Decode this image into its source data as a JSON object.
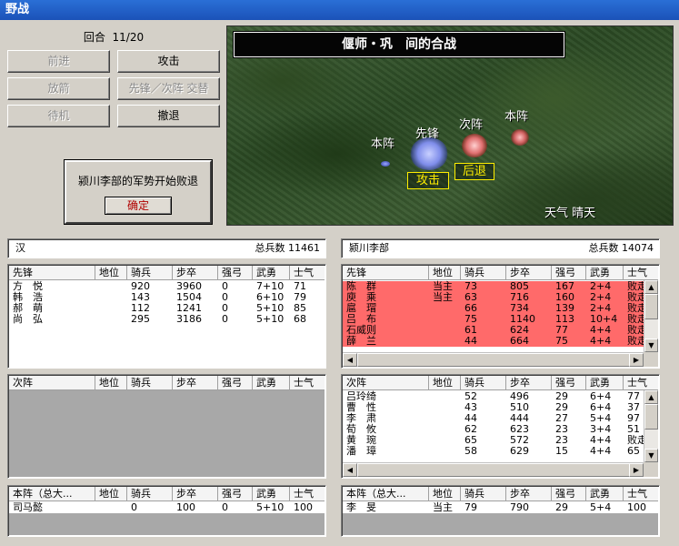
{
  "window": {
    "title": "野战"
  },
  "round": {
    "label": "回合",
    "value": "11/20"
  },
  "buttons": {
    "advance": "前进",
    "attack": "攻击",
    "volley": "放箭",
    "swap": "先锋／次阵 交替",
    "wait": "待机",
    "retreat": "撤退"
  },
  "dialog": {
    "message": "颍川李部的军势开始败退",
    "ok": "确定"
  },
  "map": {
    "title": "偃师・巩　间的合战",
    "units": {
      "left_main": "本阵",
      "left_van": "先锋",
      "right_second": "次阵",
      "right_main": "本阵"
    },
    "tags": {
      "attack": "攻击",
      "retreat": "后退"
    },
    "weather_label": "天气",
    "weather_value": "晴天"
  },
  "left_army": {
    "name": "汉",
    "total_label": "总兵数",
    "total": "11461"
  },
  "right_army": {
    "name": "颍川李部",
    "total_label": "总兵数",
    "total": "14074"
  },
  "columns": {
    "rank": "地位",
    "cavalry": "骑兵",
    "infantry": "步卒",
    "archers": "强弓",
    "valor": "武勇",
    "morale": "士气"
  },
  "group_labels": {
    "van": "先锋",
    "second": "次阵",
    "main": "本阵（总大..."
  },
  "left_van_rows": [
    {
      "name": "方　悦",
      "rank": "",
      "cav": "920",
      "inf": "3960",
      "arch": "0",
      "valor": "7+10",
      "morale": "71"
    },
    {
      "name": "韩　浩",
      "rank": "",
      "cav": "143",
      "inf": "1504",
      "arch": "0",
      "valor": "6+10",
      "morale": "79"
    },
    {
      "name": "郝　萌",
      "rank": "",
      "cav": "112",
      "inf": "1241",
      "arch": "0",
      "valor": "5+10",
      "morale": "85"
    },
    {
      "name": "尚　弘",
      "rank": "",
      "cav": "295",
      "inf": "3186",
      "arch": "0",
      "valor": "5+10",
      "morale": "68"
    }
  ],
  "left_main_rows": [
    {
      "name": "司马懿",
      "rank": "",
      "cav": "0",
      "inf": "100",
      "arch": "0",
      "valor": "5+10",
      "morale": "100"
    }
  ],
  "right_van_rows": [
    {
      "name": "陈　群",
      "rank": "当主",
      "cav": "73",
      "inf": "805",
      "arch": "167",
      "valor": "2+4",
      "morale": "败走"
    },
    {
      "name": "庾　乘",
      "rank": "当主",
      "cav": "63",
      "inf": "716",
      "arch": "160",
      "valor": "2+4",
      "morale": "败走"
    },
    {
      "name": "扈　瑁",
      "rank": "",
      "cav": "66",
      "inf": "734",
      "arch": "139",
      "valor": "2+4",
      "morale": "败走"
    },
    {
      "name": "吕　布",
      "rank": "",
      "cav": "75",
      "inf": "1140",
      "arch": "113",
      "valor": "10+4",
      "morale": "败走"
    },
    {
      "name": "石威则",
      "rank": "",
      "cav": "61",
      "inf": "624",
      "arch": "77",
      "valor": "4+4",
      "morale": "败走"
    },
    {
      "name": "薛　兰",
      "rank": "",
      "cav": "44",
      "inf": "664",
      "arch": "75",
      "valor": "4+4",
      "morale": "败走"
    }
  ],
  "right_second_rows": [
    {
      "name": "吕玲绮",
      "rank": "",
      "cav": "52",
      "inf": "496",
      "arch": "29",
      "valor": "6+4",
      "morale": "77"
    },
    {
      "name": "曹　性",
      "rank": "",
      "cav": "43",
      "inf": "510",
      "arch": "29",
      "valor": "6+4",
      "morale": "37"
    },
    {
      "name": "李　肃",
      "rank": "",
      "cav": "44",
      "inf": "444",
      "arch": "27",
      "valor": "5+4",
      "morale": "97"
    },
    {
      "name": "荀　攸",
      "rank": "",
      "cav": "62",
      "inf": "623",
      "arch": "23",
      "valor": "3+4",
      "morale": "51"
    },
    {
      "name": "黄　琬",
      "rank": "",
      "cav": "65",
      "inf": "572",
      "arch": "23",
      "valor": "4+4",
      "morale": "败走"
    },
    {
      "name": "潘　璋",
      "rank": "",
      "cav": "58",
      "inf": "629",
      "arch": "15",
      "valor": "4+4",
      "morale": "65"
    }
  ],
  "right_main_rows": [
    {
      "name": "李　旻",
      "rank": "当主",
      "cav": "79",
      "inf": "790",
      "arch": "29",
      "valor": "5+4",
      "morale": "100"
    }
  ],
  "colors": {
    "defeated_row": "#ff6a6a",
    "tag_yellow": "#ffee00",
    "title_blue": "#1b52b8"
  }
}
